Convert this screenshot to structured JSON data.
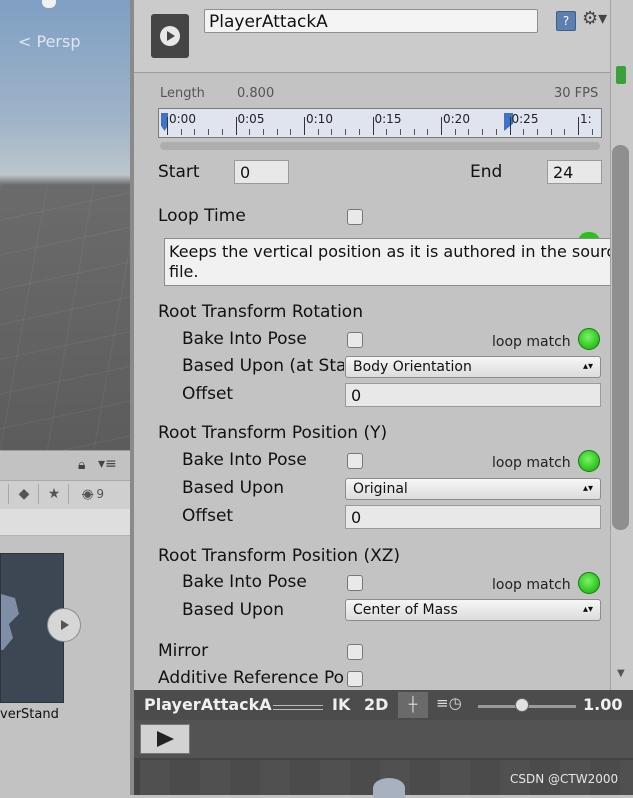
{
  "scene": {
    "persp_label": "< Persp"
  },
  "project": {
    "lock_icon": "lock-icon",
    "menu_icon": "list-menu-icon",
    "asset_label": "verStand",
    "filter_partial": "9"
  },
  "inspector": {
    "clip_name": "PlayerAttackA",
    "length_label": "Length",
    "length_value": "0.800",
    "fps_label": "30 FPS",
    "ticks": [
      "0:00",
      "0:05",
      "0:10",
      "0:15",
      "0:20",
      "0:25",
      "1:"
    ],
    "start_label": "Start",
    "start_value": "0",
    "end_label": "End",
    "end_value": "24",
    "loop_time_label": "Loop Time",
    "tooltip": "Keeps the vertical position as it is authored in the source file.",
    "rot": {
      "title": "Root Transform Rotation",
      "bake_label": "Bake Into Pose",
      "loop_match": "loop match",
      "based_label": "Based Upon (at Star",
      "based_value": "Body Orientation",
      "offset_label": "Offset",
      "offset_value": "0"
    },
    "posy": {
      "title": "Root Transform Position (Y)",
      "bake_label": "Bake Into Pose",
      "loop_match": "loop match",
      "based_label": "Based Upon",
      "based_value": "Original",
      "offset_label": "Offset",
      "offset_value": "0"
    },
    "posxz": {
      "title": "Root Transform Position (XZ)",
      "bake_label": "Bake Into Pose",
      "loop_match": "loop match",
      "based_label": "Based Upon",
      "based_value": "Center of Mass"
    },
    "mirror_label": "Mirror",
    "additive_label": "Additive Reference Po"
  },
  "preview": {
    "name": "PlayerAttackA",
    "ik": "IK",
    "twod": "2D",
    "speed": "1.00",
    "speed_fraction": 0.45
  },
  "watermark": "CSDN @CTW2000",
  "colors": {
    "loop_match_ok": "#28c31a",
    "preview_bar": "#4c4c4c",
    "inspector_bg": "#c3c3c3"
  }
}
